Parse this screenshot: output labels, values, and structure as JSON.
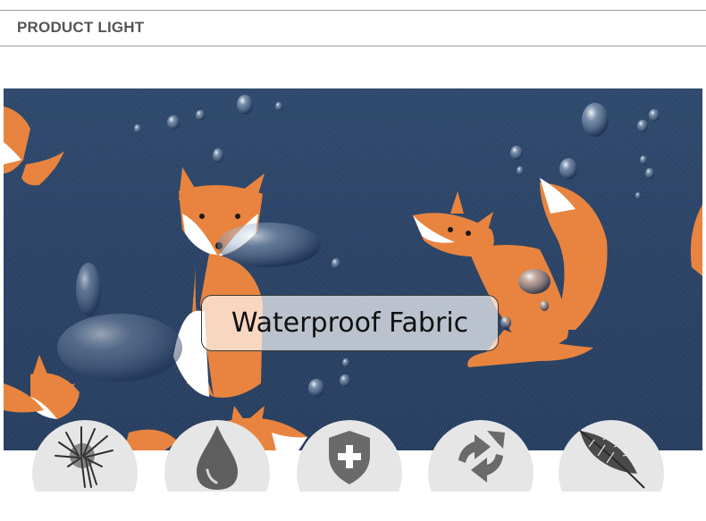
{
  "header": {
    "title": "PRODUCT LIGHT"
  },
  "banner": {
    "caption": "Waterproof Fabric"
  },
  "features": [
    {
      "icon": "dandelion-icon"
    },
    {
      "icon": "water-drop-icon"
    },
    {
      "icon": "shield-cross-icon"
    },
    {
      "icon": "recycle-arrows-icon"
    },
    {
      "icon": "feather-icon"
    }
  ],
  "colors": {
    "fabric": "#2c4669",
    "fox": "#e8843f",
    "header_text": "#555555",
    "icon_bg": "#e6e6e6"
  }
}
